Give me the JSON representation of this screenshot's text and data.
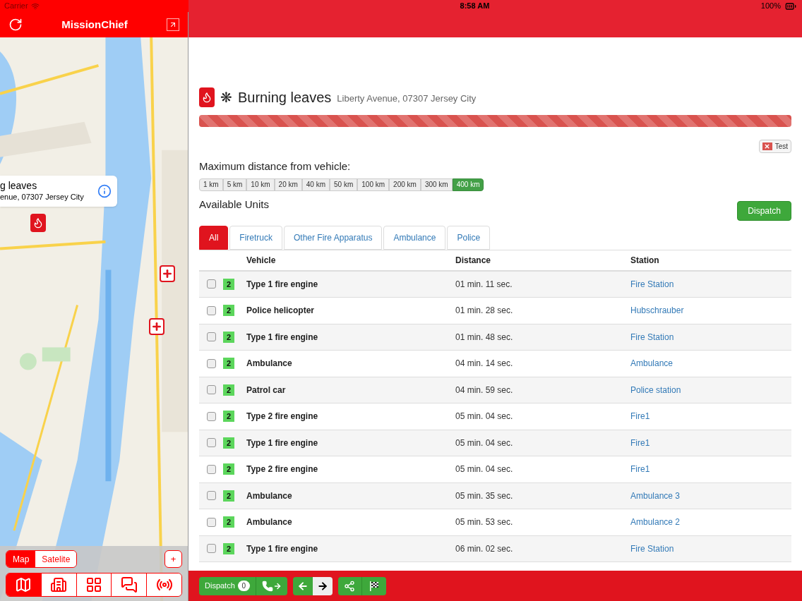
{
  "status_bar": {
    "carrier": "Carrier",
    "time": "8:58 AM",
    "battery": "100%"
  },
  "sidebar": {
    "title": "MissionChief",
    "map_popup": {
      "title": "g leaves",
      "subtitle": "enue, 07307 Jersey City"
    },
    "map_types": [
      {
        "label": "Map",
        "selected": true
      },
      {
        "label": "Satelite",
        "selected": false
      }
    ],
    "zoom_button": "+",
    "nav": [
      {
        "kind": "map",
        "selected": true
      },
      {
        "kind": "buildings",
        "selected": false
      },
      {
        "kind": "list",
        "selected": false
      },
      {
        "kind": "chat",
        "selected": false
      },
      {
        "kind": "radio",
        "selected": false
      }
    ]
  },
  "mission": {
    "title": "Burning leaves",
    "symbol": "❋",
    "address": "Liberty Avenue, 07307 Jersey City",
    "progress": {
      "level": 1
    },
    "test_button": "Test"
  },
  "distance": {
    "label": "Maximum distance from vehicle:",
    "options": [
      {
        "label": "1 km",
        "selected": false
      },
      {
        "label": "5 km",
        "selected": false
      },
      {
        "label": "10 km",
        "selected": false
      },
      {
        "label": "20 km",
        "selected": false
      },
      {
        "label": "40 km",
        "selected": false
      },
      {
        "label": "50 km",
        "selected": false
      },
      {
        "label": "100 km",
        "selected": false
      },
      {
        "label": "200 km",
        "selected": false
      },
      {
        "label": "300 km",
        "selected": false
      },
      {
        "label": "400 km",
        "selected": true
      }
    ]
  },
  "units_heading": "Available Units",
  "dispatch_button": "Dispatch",
  "tabs": [
    {
      "label": "All",
      "selected": true
    },
    {
      "label": "Firetruck",
      "selected": false
    },
    {
      "label": "Other Fire Apparatus",
      "selected": false
    },
    {
      "label": "Ambulance",
      "selected": false
    },
    {
      "label": "Police",
      "selected": false
    }
  ],
  "table": {
    "columns": [
      "Vehicle",
      "Distance",
      "Station"
    ],
    "rows": [
      {
        "checked": false,
        "badge": "2",
        "vehicle": "Type 1 fire engine",
        "distance": "01 min. 11 sec.",
        "station": "Fire Station"
      },
      {
        "checked": false,
        "badge": "2",
        "vehicle": "Police helicopter",
        "distance": "01 min. 28 sec.",
        "station": "Hubschrauber"
      },
      {
        "checked": false,
        "badge": "2",
        "vehicle": "Type 1 fire engine",
        "distance": "01 min. 48 sec.",
        "station": "Fire Station"
      },
      {
        "checked": false,
        "badge": "2",
        "vehicle": "Ambulance",
        "distance": "04 min. 14 sec.",
        "station": "Ambulance"
      },
      {
        "checked": false,
        "badge": "2",
        "vehicle": "Patrol car",
        "distance": "04 min. 59 sec.",
        "station": "Police station"
      },
      {
        "checked": false,
        "badge": "2",
        "vehicle": "Type 2 fire engine",
        "distance": "05 min. 04 sec.",
        "station": "Fire1"
      },
      {
        "checked": false,
        "badge": "2",
        "vehicle": "Type 1 fire engine",
        "distance": "05 min. 04 sec.",
        "station": "Fire1"
      },
      {
        "checked": false,
        "badge": "2",
        "vehicle": "Type 2 fire engine",
        "distance": "05 min. 04 sec.",
        "station": "Fire1"
      },
      {
        "checked": false,
        "badge": "2",
        "vehicle": "Ambulance",
        "distance": "05 min. 35 sec.",
        "station": "Ambulance 3"
      },
      {
        "checked": false,
        "badge": "2",
        "vehicle": "Ambulance",
        "distance": "05 min. 53 sec.",
        "station": "Ambulance 2"
      },
      {
        "checked": false,
        "badge": "2",
        "vehicle": "Type 1 fire engine",
        "distance": "06 min. 02 sec.",
        "station": "Fire Station"
      }
    ]
  },
  "toolbar": {
    "dispatch_label": "Dispatch",
    "dispatch_count": "0",
    "arrows": [
      {
        "kind": "prev",
        "selected": false
      },
      {
        "kind": "next",
        "selected": true
      }
    ]
  }
}
